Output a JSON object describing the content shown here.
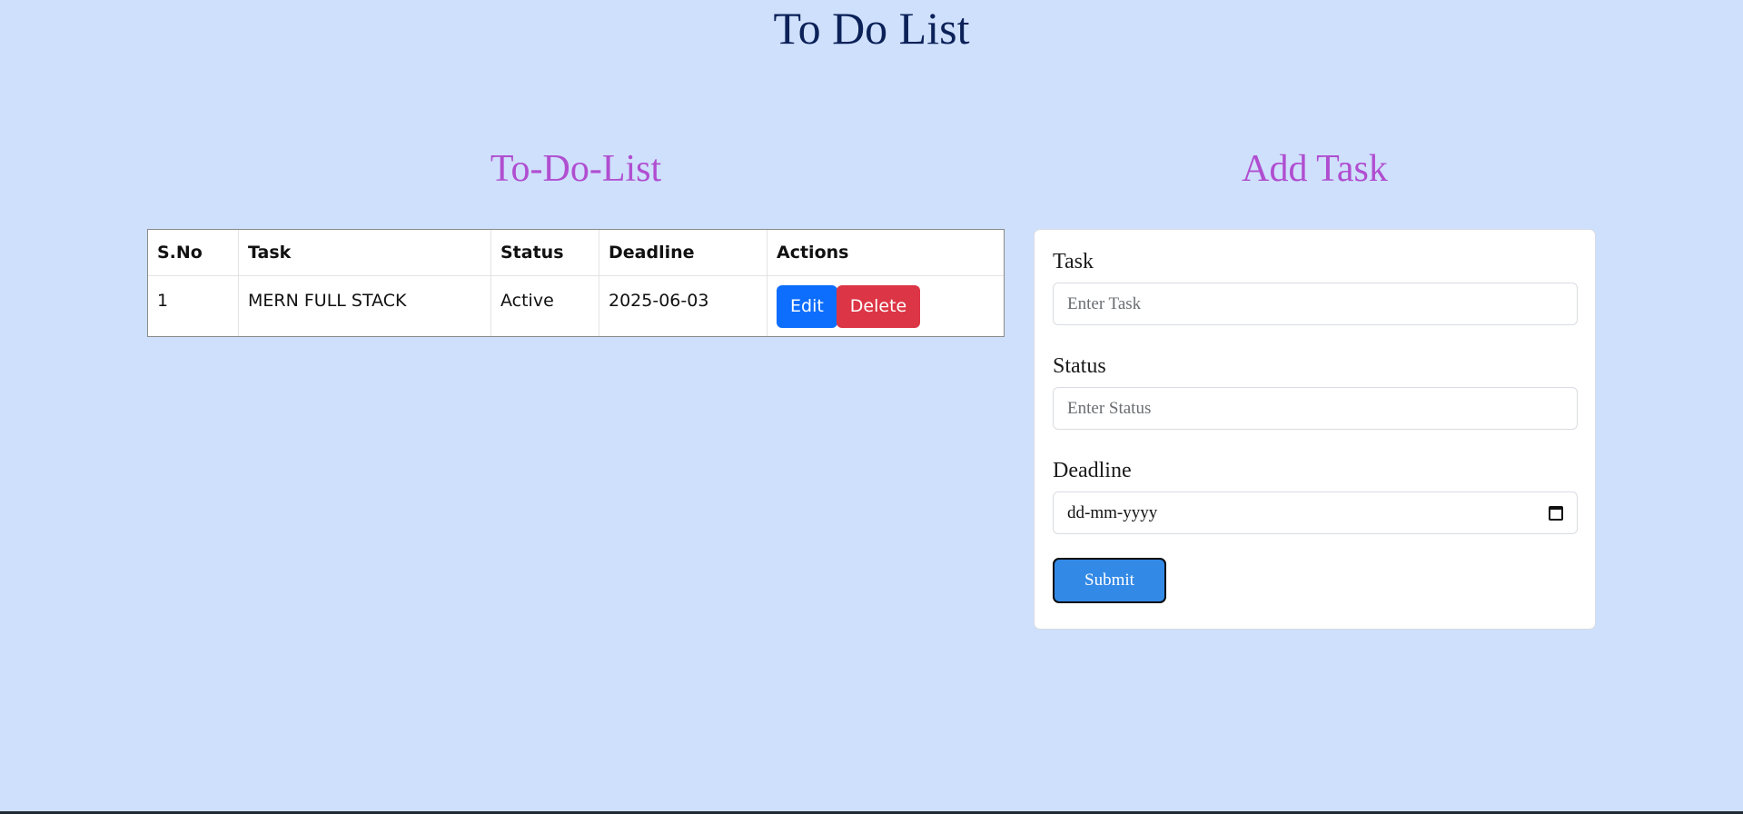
{
  "page": {
    "title": "To Do List"
  },
  "todo_list": {
    "heading": "To-Do-List",
    "columns": [
      "S.No",
      "Task",
      "Status",
      "Deadline",
      "Actions"
    ],
    "rows": [
      {
        "sno": "1",
        "task": "MERN FULL STACK",
        "status": "Active",
        "deadline": "2025-06-03",
        "edit_label": "Edit",
        "delete_label": "Delete"
      }
    ]
  },
  "add_task": {
    "heading": "Add Task",
    "task_label": "Task",
    "task_placeholder": "Enter Task",
    "task_value": "",
    "status_label": "Status",
    "status_placeholder": "Enter Status",
    "status_value": "",
    "deadline_label": "Deadline",
    "deadline_placeholder": "dd-mm-yyyy",
    "submit_label": "Submit"
  },
  "colors": {
    "background": "#cfe0fd",
    "title": "#0b2158",
    "section_heading": "#b04ed0",
    "edit_button": "#0d6efd",
    "delete_button": "#dc3545",
    "submit_button": "#3389e6"
  }
}
